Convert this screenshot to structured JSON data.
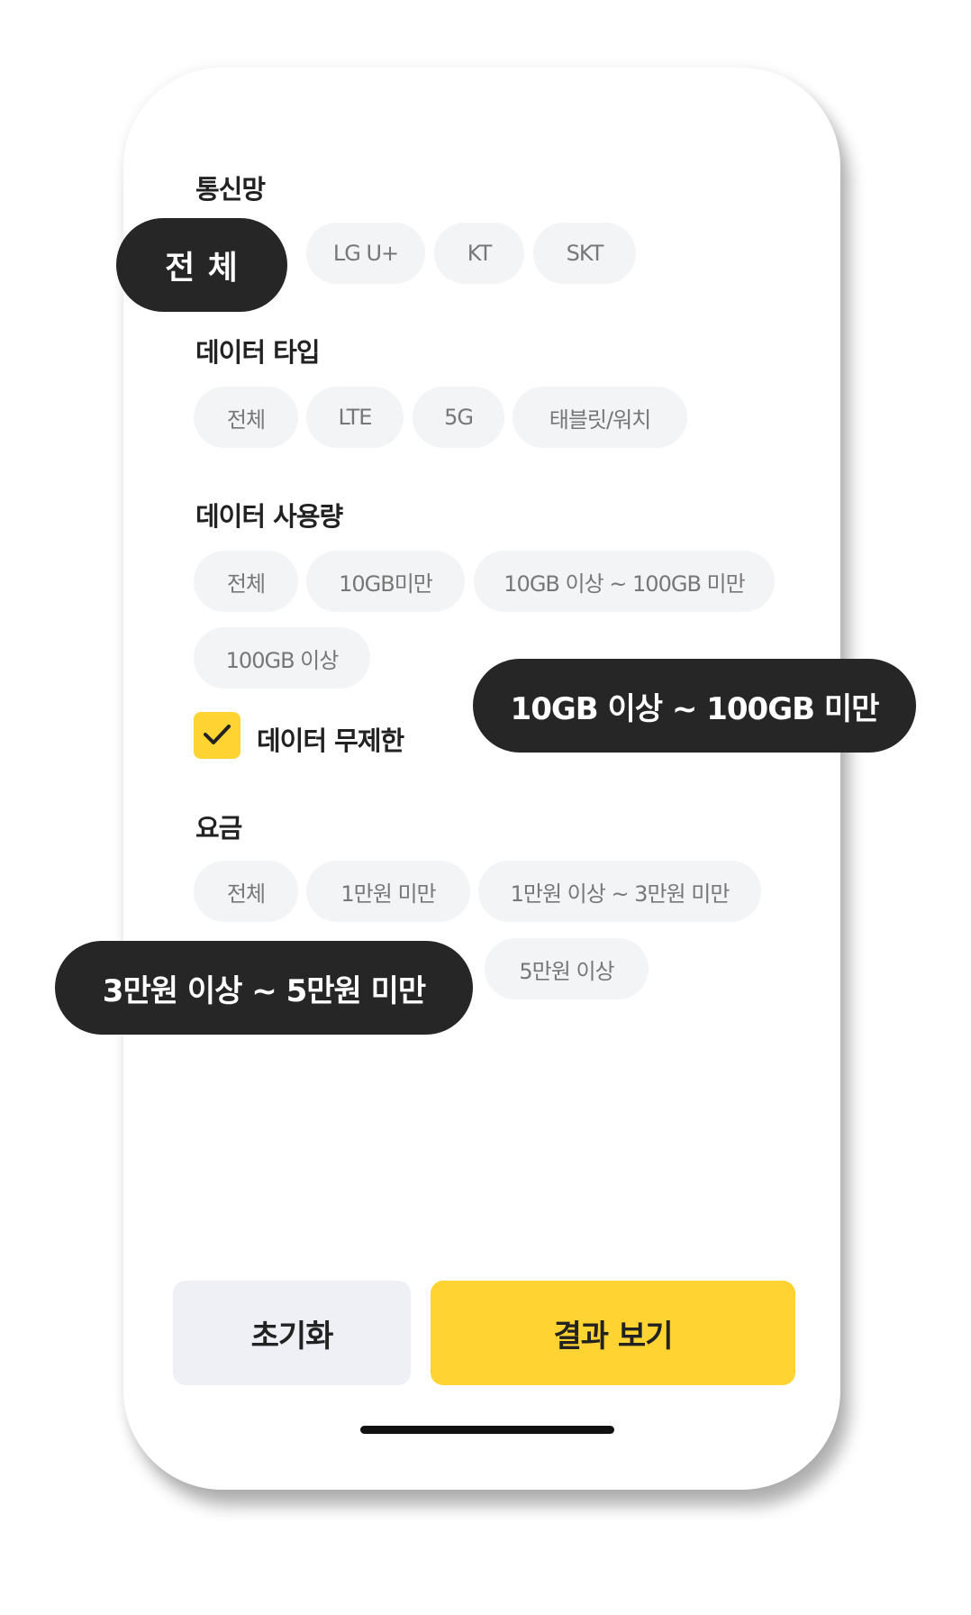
{
  "network": {
    "title": "통신망",
    "options": [
      "전 체",
      "LG U+",
      "KT",
      "SKT"
    ]
  },
  "data_type": {
    "title": "데이터 타입",
    "options": [
      "전체",
      "LTE",
      "5G",
      "태블릿/워치"
    ]
  },
  "data_usage": {
    "title": "데이터 사용량",
    "options": [
      "전체",
      "10GB미만",
      "10GB 이상 ~ 100GB 미만",
      "100GB 이상"
    ],
    "callout": "10GB 이상 ~ 100GB 미만",
    "unlimited_label": "데이터 무제한",
    "unlimited_checked": true
  },
  "price": {
    "title": "요금",
    "options": [
      "전체",
      "1만원 미만",
      "1만원 이상 ~ 3만원 미만",
      "5만원 이상"
    ],
    "callout": "3만원 이상 ~ 5만원 미만"
  },
  "footer": {
    "reset_label": "초기화",
    "result_label": "결과 보기"
  },
  "colors": {
    "accent": "#ffd331",
    "selected": "#262626",
    "chip_bg": "#f3f4f6"
  },
  "icons": {
    "checkbox": "check-icon"
  }
}
